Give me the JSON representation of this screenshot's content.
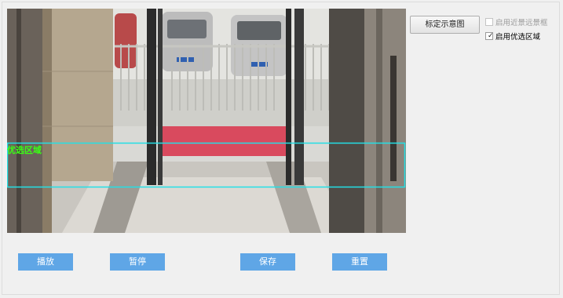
{
  "preview": {
    "roi_label": "优选区域",
    "roi_color": "#39ff14",
    "roi_box_color": "#22e0e6"
  },
  "right_panel": {
    "calibration_button": "标定示意图",
    "checkboxes": [
      {
        "label": "启用近景远景框",
        "checked": false,
        "enabled": false
      },
      {
        "label": "启用优选区域",
        "checked": true,
        "enabled": true
      }
    ]
  },
  "actions": {
    "play": "播放",
    "pause": "暂停",
    "save": "保存",
    "reset": "重置",
    "button_color": "#5fa6e6"
  }
}
